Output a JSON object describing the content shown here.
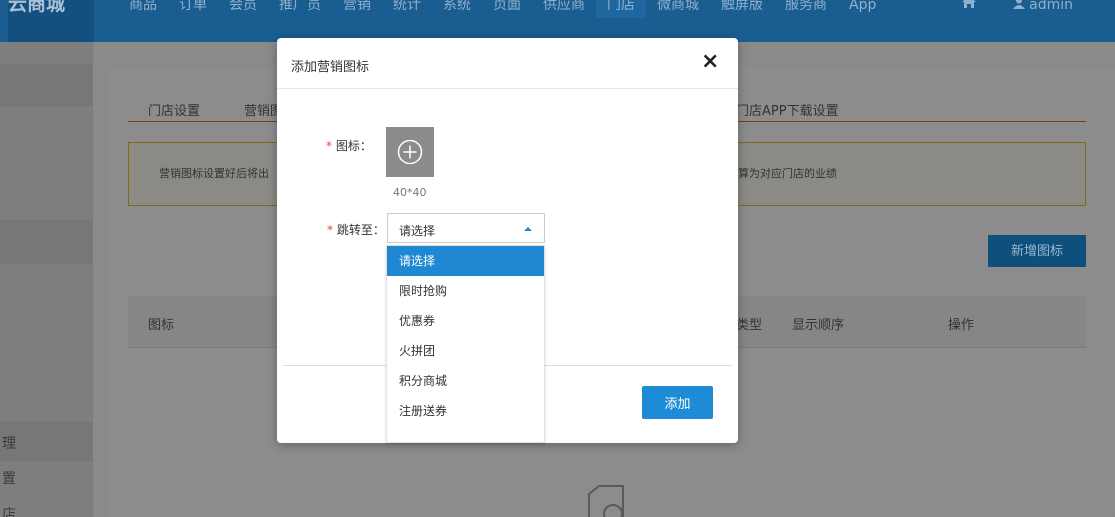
{
  "header": {
    "logo_text": "云商城",
    "nav": [
      "商品",
      "订单",
      "会员",
      "推广员",
      "营销",
      "统计",
      "系统",
      "页面",
      "供应商",
      "门店",
      "微商城",
      "触屏版",
      "服务商",
      "App"
    ],
    "active_nav": "门店",
    "home_icon": "home-icon",
    "user_icon": "user-icon",
    "user_name": "admin"
  },
  "sidebar": {
    "items": [
      "理",
      "置",
      "店"
    ]
  },
  "page": {
    "tabs": [
      "门店设置",
      "营销图",
      "门店APP下载设置"
    ],
    "notice_left": "营销图标设置好后将出",
    "notice_right": "算为对应门店的业绩",
    "add_button": "新增图标",
    "columns": [
      "图标",
      "类型",
      "显示顺序",
      "操作"
    ]
  },
  "modal": {
    "title": "添加营销图标",
    "close": "×",
    "required_mark": "*",
    "icon_label": "图标：",
    "size_hint": "40*40",
    "jump_label": "跳转至：",
    "select_value": "请选择",
    "options": [
      "请选择",
      "限时抢购",
      "优惠券",
      "火拼团",
      "积分商城",
      "注册送券"
    ],
    "selected_option": "请选择",
    "submit": "添加"
  },
  "colors": {
    "primary": "#1e8bd6",
    "required": "#e5463b"
  }
}
